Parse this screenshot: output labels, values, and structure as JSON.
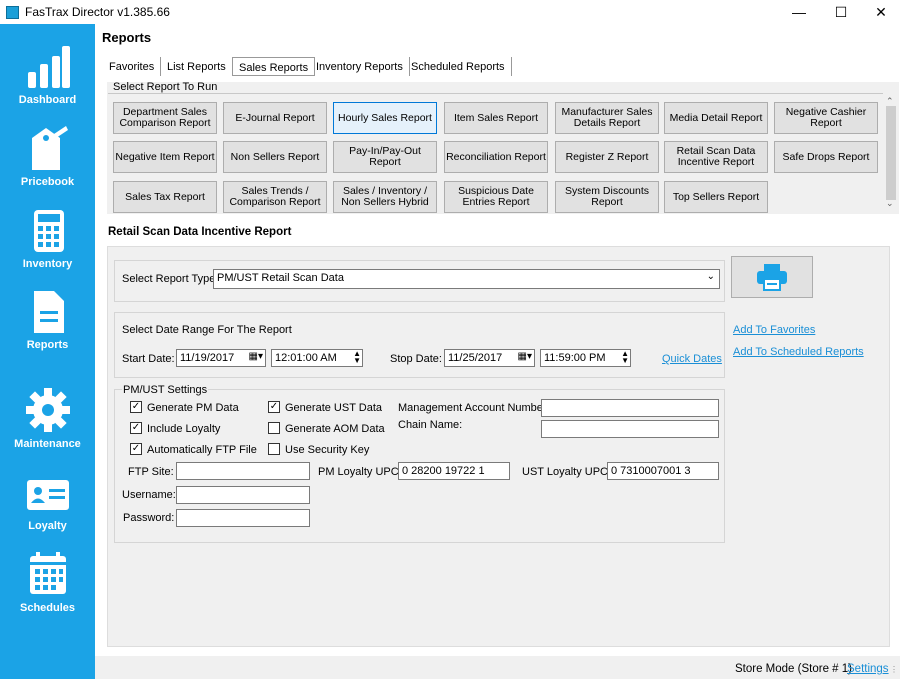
{
  "window": {
    "title": "FasTrax Director v1.385.66"
  },
  "sidebar": {
    "items": [
      {
        "label": "Dashboard"
      },
      {
        "label": "Pricebook"
      },
      {
        "label": "Inventory"
      },
      {
        "label": "Reports"
      },
      {
        "label": "Maintenance"
      },
      {
        "label": "Loyalty"
      },
      {
        "label": "Schedules"
      }
    ]
  },
  "page": {
    "title": "Reports"
  },
  "tabs": [
    "Favorites",
    "List Reports",
    "Sales Reports",
    "Inventory Reports",
    "Scheduled Reports"
  ],
  "panel_header": "Select Report To Run",
  "reports": [
    "Department Sales Comparison Report",
    "E-Journal Report",
    "Hourly Sales Report",
    "Item Sales Report",
    "Manufacturer Sales Details Report",
    "Media Detail Report",
    "Negative Cashier Report",
    "Negative Item Report",
    "Non Sellers Report",
    "Pay-In/Pay-Out Report",
    "Reconciliation Report",
    "Register Z Report",
    "Retail Scan Data Incentive Report",
    "Safe Drops Report",
    "Sales Tax Report",
    "Sales Trends / Comparison Report",
    "Sales / Inventory / Non Sellers Hybrid",
    "Suspicious Date Entries Report",
    "System Discounts Report",
    "Top Sellers Report"
  ],
  "section_title": "Retail Scan Data Incentive Report",
  "report_type": {
    "label": "Select Report Type:",
    "value": "PM/UST Retail Scan Data"
  },
  "date_range": {
    "title": "Select Date Range For The Report",
    "start_label": "Start Date:",
    "start_date": "11/19/2017",
    "start_time": "12:01:00 AM",
    "stop_label": "Stop Date:",
    "stop_date": "11/25/2017",
    "stop_time": "11:59:00 PM",
    "quick_dates": "Quick Dates"
  },
  "links": {
    "favorites": "Add To Favorites",
    "scheduled": "Add To Scheduled Reports"
  },
  "settings": {
    "title": "PM/UST Settings",
    "generate_pm": "Generate PM Data",
    "include_loyalty": "Include Loyalty",
    "auto_ftp": "Automatically FTP File",
    "generate_ust": "Generate UST Data",
    "generate_aom": "Generate AOM Data",
    "use_security_key": "Use Security Key",
    "mgmt_account_label": "Management Account Number:",
    "chain_name_label": "Chain Name:",
    "ftp_site_label": "FTP Site:",
    "username_label": "Username:",
    "password_label": "Password:",
    "pm_upc_label": "PM Loyalty UPC:",
    "pm_upc_value": "0 28200 19722 1",
    "ust_upc_label": "UST Loyalty UPC:",
    "ust_upc_value": "0 7310007001 3"
  },
  "status": {
    "mode": "Store Mode (Store # 1)",
    "settings": "Settings"
  }
}
